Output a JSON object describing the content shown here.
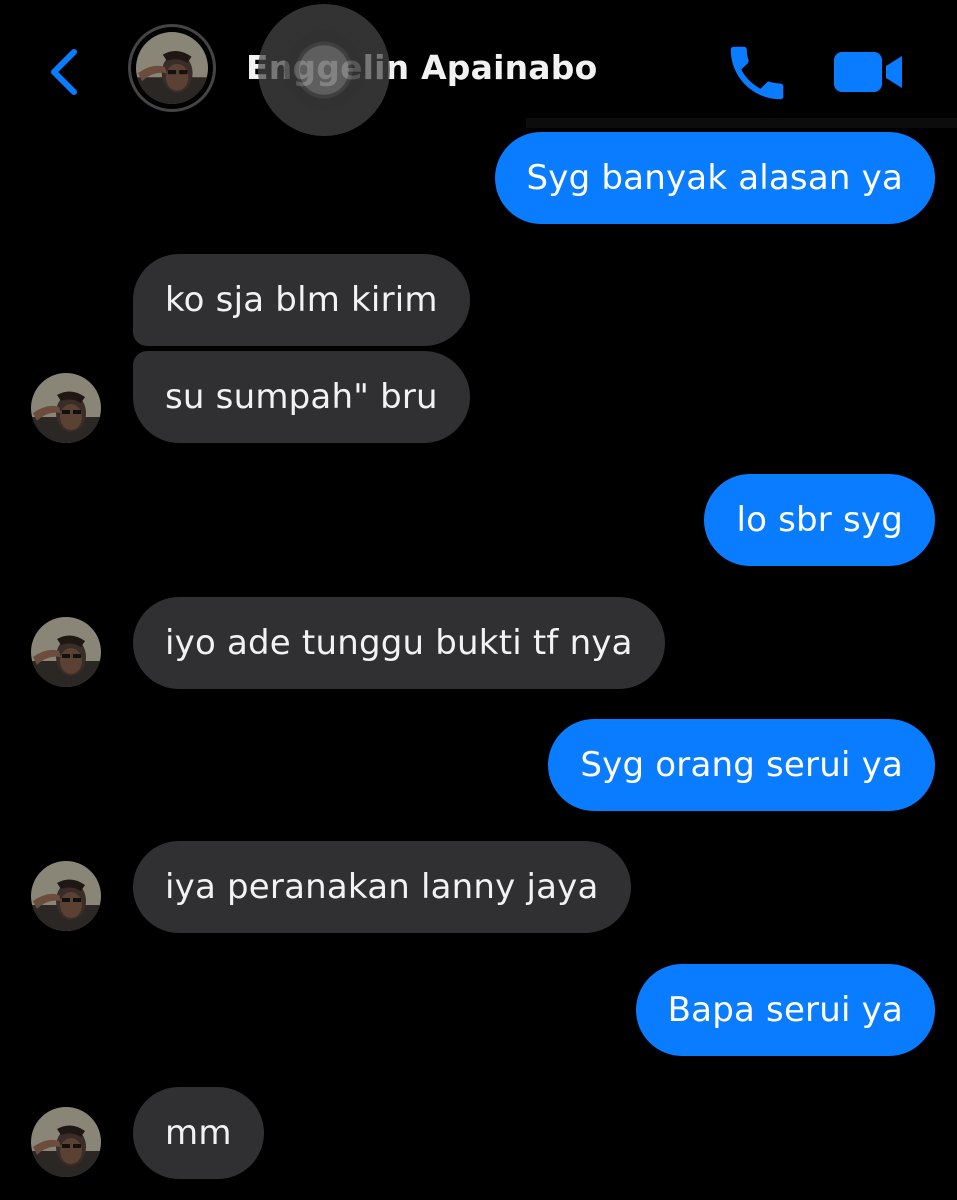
{
  "header": {
    "contact_name": "Enggelin Apainabo",
    "back_icon": "chevron-left-icon",
    "call_icon": "phone-icon",
    "video_icon": "video-camera-icon"
  },
  "colors": {
    "accent": "#0a7cff",
    "received_bubble": "#303033",
    "background": "#000000"
  },
  "messages": [
    {
      "from": "me",
      "text": "Syg banyak alasan ya"
    },
    {
      "from": "contact",
      "text": "ko sja blm kirim"
    },
    {
      "from": "contact",
      "text": "su sumpah\" bru"
    },
    {
      "from": "me",
      "text": "lo sbr syg"
    },
    {
      "from": "contact",
      "text": "iyo ade tunggu bukti tf nya"
    },
    {
      "from": "me",
      "text": "Syg orang serui ya"
    },
    {
      "from": "contact",
      "text": "iya peranakan lanny jaya"
    },
    {
      "from": "me",
      "text": "Bapa serui ya"
    },
    {
      "from": "contact",
      "text": "mm"
    }
  ]
}
